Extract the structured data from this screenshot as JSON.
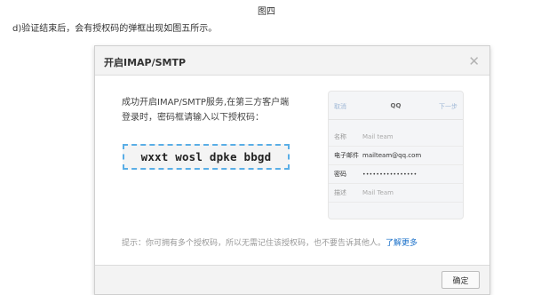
{
  "doc": {
    "figure_caption": "图四",
    "instruction": "d)验证结束后，会有授权码的弹框出现如图五所示。"
  },
  "dialog": {
    "title": "开启IMAP/SMTP",
    "close_icon": "close-icon",
    "description_line1": "成功开启IMAP/SMTP服务,在第三方客户端",
    "description_line2": "登录时，密码框请输入以下授权码：",
    "auth_code": "wxxt wosl dpke bbgd",
    "hint_text": "提示：你可拥有多个授权码，所以无需记住该授权码，也不要告诉其他人。",
    "hint_link": "了解更多",
    "ok_label": "确定",
    "phone": {
      "cancel": "取消",
      "title": "QQ",
      "next": "下一步",
      "rows": [
        {
          "label": "名称",
          "value": "Mail team"
        },
        {
          "label": "电子邮件",
          "value": "mailteam@qq.com"
        },
        {
          "label": "密码",
          "value": "••••••••••••••••"
        },
        {
          "label": "描述",
          "value": "Mail Team"
        }
      ]
    }
  },
  "colors": {
    "accent_link": "#1a70c9",
    "code_border": "#5aaee6"
  }
}
